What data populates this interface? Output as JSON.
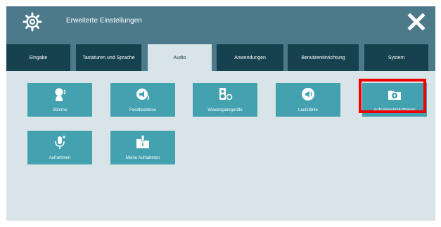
{
  "window": {
    "title": "Erweiterte Einstellungen",
    "gear_icon": "gear-icon",
    "close_icon": "close-icon"
  },
  "tabs": [
    {
      "label": "Eingabe",
      "active": false
    },
    {
      "label": "Tastaturen und Sprache",
      "active": false
    },
    {
      "label": "Audio",
      "active": true
    },
    {
      "label": "Anwendungen",
      "active": false
    },
    {
      "label": "Benutzereinrichtung",
      "active": false
    },
    {
      "label": "System",
      "active": false
    }
  ],
  "tiles": [
    {
      "label": "Stimme",
      "icon": "voice-icon"
    },
    {
      "label": "Feedbacktöne",
      "icon": "feedback-tones-icon"
    },
    {
      "label": "Wiedergabegeräte",
      "icon": "playback-devices-icon"
    },
    {
      "label": "Lautstärke",
      "icon": "volume-icon"
    },
    {
      "label": "Aufnahmebibliotheken",
      "icon": "recording-libraries-icon"
    },
    {
      "label": "Aufnehmen",
      "icon": "record-microphone-icon"
    },
    {
      "label": "Meine Aufnahmen",
      "icon": "my-recordings-icon"
    }
  ],
  "colors": {
    "titlebar": "#4c7a8b",
    "tab_inactive": "#16414e",
    "tab_active": "#d9e4e8",
    "tile": "#44a1b0",
    "content_bg": "#d9e4e8",
    "highlight": "#f00000"
  }
}
